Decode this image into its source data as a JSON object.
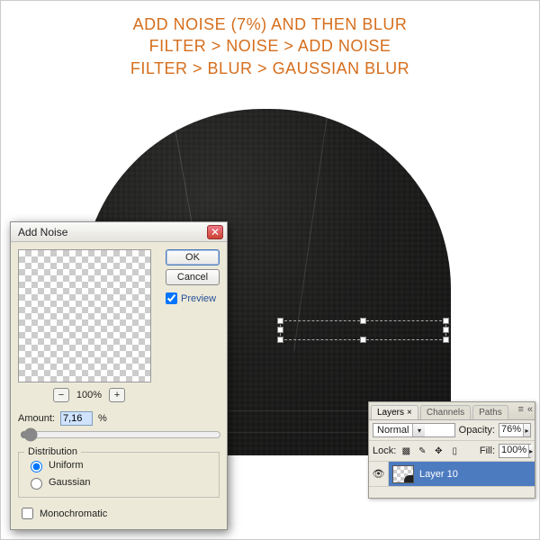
{
  "instructions": {
    "line1": "ADD NOISE (7%) AND THEN BLUR",
    "line2": "FILTER > NOISE > ADD NOISE",
    "line3": "FILTER > BLUR > GAUSSIAN BLUR"
  },
  "dialog": {
    "title": "Add Noise",
    "ok": "OK",
    "cancel": "Cancel",
    "preview_label": "Preview",
    "preview_checked": true,
    "zoom": "100%",
    "amount_label": "Amount:",
    "amount_value": "7,16",
    "amount_unit": "%",
    "distribution_legend": "Distribution",
    "uniform_label": "Uniform",
    "gaussian_label": "Gaussian",
    "distribution_selected": "uniform",
    "monochromatic_label": "Monochromatic",
    "monochromatic_checked": false
  },
  "layers_panel": {
    "tabs": {
      "layers": "Layers",
      "channels": "Channels",
      "paths": "Paths"
    },
    "blend_mode": "Normal",
    "opacity_label": "Opacity:",
    "opacity_value": "76%",
    "lock_label": "Lock:",
    "fill_label": "Fill:",
    "fill_value": "100%",
    "layer_name": "Layer 10"
  }
}
